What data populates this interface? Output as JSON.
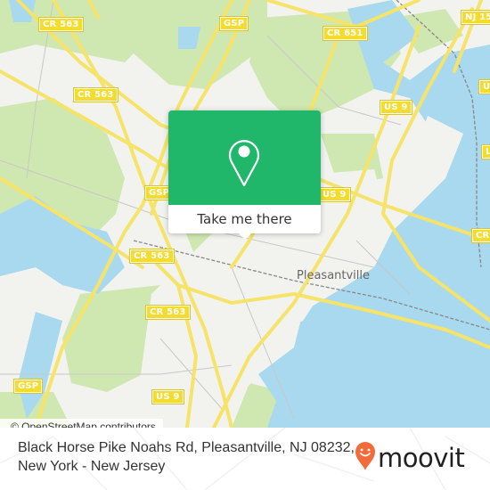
{
  "map": {
    "road_shields": [
      {
        "id": "cr563-a",
        "label": "CR 563"
      },
      {
        "id": "gsp-a",
        "label": "GSP"
      },
      {
        "id": "cr563-b",
        "label": "CR 563"
      },
      {
        "id": "cr651",
        "label": "CR 651"
      },
      {
        "id": "nj15x",
        "label": "NJ 15"
      },
      {
        "id": "us9-a",
        "label": "US 9"
      },
      {
        "id": "us9-b",
        "label": "US 9"
      },
      {
        "id": "gsp-b",
        "label": "GSP"
      },
      {
        "id": "cr563-c",
        "label": "CR 563"
      },
      {
        "id": "cr-east",
        "label": "CR"
      },
      {
        "id": "cr563-d",
        "label": "CR 563"
      },
      {
        "id": "gsp-c",
        "label": "GSP"
      },
      {
        "id": "us9-c",
        "label": "US 9"
      },
      {
        "id": "us9-edge",
        "label": "US"
      },
      {
        "id": "l-edge",
        "label": "L"
      }
    ],
    "place_labels": [
      {
        "label": "Pleasantville"
      }
    ],
    "colors": {
      "land": "#f2f2ef",
      "park": "#cfe7b0",
      "water": "#a9d9ee",
      "road": "#f6e36a",
      "popup": "#21b76b"
    }
  },
  "popup": {
    "icon": "map-pin-icon",
    "button_label": "Take me there"
  },
  "attribution": "© OpenStreetMap contributors",
  "footer": {
    "address_line1": "Black Horse Pike Noahs Rd, Pleasantville, NJ 08232,",
    "address_line2": "New York - New Jersey",
    "brand": "moovit",
    "brand_color": "#f26b3a"
  }
}
